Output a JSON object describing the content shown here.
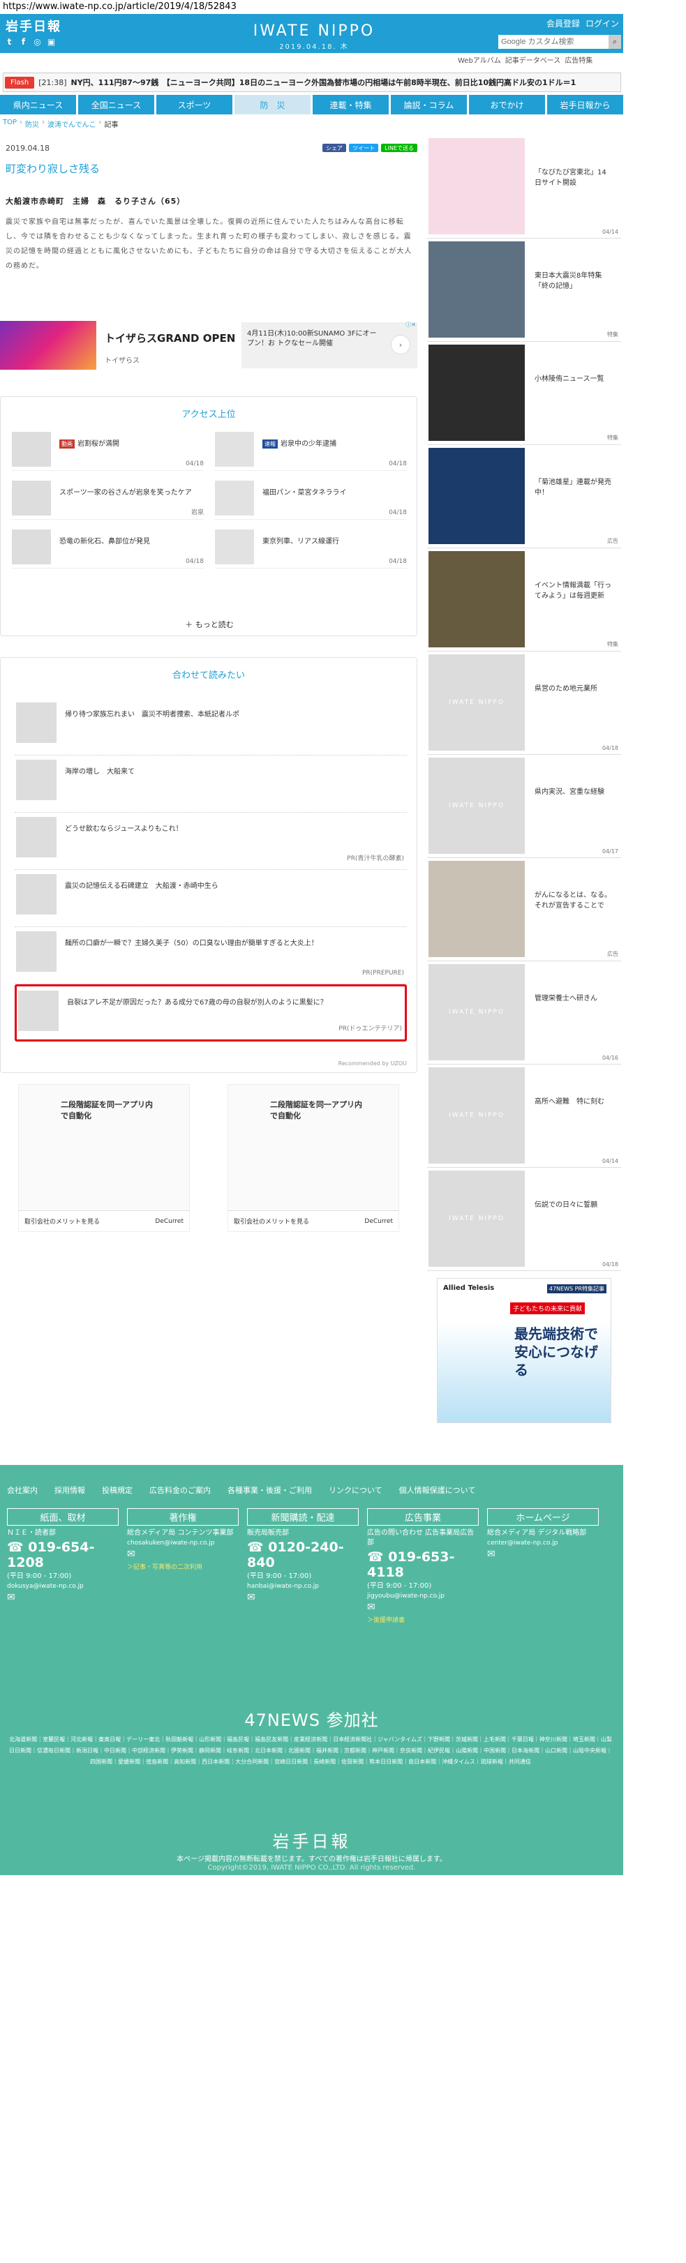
{
  "url": "https://www.iwate-np.co.jp/article/2019/4/18/52843",
  "header": {
    "logo": "岩手日報",
    "brand": "IWATE NIPPO",
    "date": "2019.04.18. 木",
    "member_links": [
      "会員登録",
      "ログイン"
    ],
    "search_placeholder": "Google カスタム検索",
    "sub_links": [
      "Webアルバム",
      "記事データベース",
      "広告特集"
    ],
    "social_icons": [
      "twitter-icon",
      "facebook-icon",
      "line-icon",
      "instagram-icon"
    ]
  },
  "flash": {
    "badge": "Flash",
    "time": "[21:38]",
    "text": "NY円、111円87～97銭　【ニューヨーク共同】18日のニューヨーク外国為替市場の円相場は午前8時半現在、前日比10銭円高ドル安の1ドル＝1"
  },
  "nav": [
    "県内ニュース",
    "全国ニュース",
    "スポーツ",
    "防　災",
    "連載・特集",
    "論説・コラム",
    "おでかけ",
    "岩手日報から"
  ],
  "breadcrumb": [
    "TOP",
    "防災",
    "波涛でんでんこ",
    "記事"
  ],
  "article": {
    "date": "2019.04.18",
    "title": "町変わり寂しさ残る",
    "byline": "大船渡市赤崎町　主婦　森　るり子さん（65）",
    "body": "震災で家族や自宅は無事だったが、喜んでいた風景は全壊した。復興の近所に住んでいた人たちはみんな高台に移転し、今では隣を合わせることも少なくなってしまった。生まれ育った町の様子も変わってしまい、寂しさを感じる。震災の記憶を時間の経過とともに風化させないためにも、子どもたちに自分の命は自分で守る大切さを伝えることが大人の務めだ。",
    "share": [
      "シェア",
      "ツイート",
      "LINEで送る"
    ]
  },
  "ad1": {
    "title": "トイザらスGRAND OPEN",
    "advertiser": "トイザらス",
    "text": "4月11日(木)10:00新SUNAMO 3Fにオープン！お トクなセール開催"
  },
  "access": {
    "title": "アクセス上位",
    "items": [
      {
        "tag": "動画",
        "tag_color": "#c83a2e",
        "text": "岩割桜が満開",
        "date": "04/18"
      },
      {
        "tag": "速報",
        "tag_color": "#1f4e9e",
        "text": "岩泉中の少年逮捕",
        "date": "04/18"
      },
      {
        "tag": "",
        "tag_color": "",
        "text": "スポーツ一家の谷さんが岩泉を笑ったケア",
        "date": "岩泉"
      },
      {
        "tag": "",
        "tag_color": "",
        "text": "福田パン・菜宮タネラライ",
        "date": "04/18"
      },
      {
        "tag": "",
        "tag_color": "",
        "text": "恐竜の新化石、鼻部位が発見",
        "date": "04/18"
      },
      {
        "tag": "",
        "tag_color": "",
        "text": "東京列車、リアス線運行",
        "date": "04/18"
      }
    ],
    "more": "もっと読む"
  },
  "related": {
    "title": "合わせて読みたい",
    "items": [
      {
        "text": "帰り待つ家族忘れまい　震災不明者捜索、本紙記者ルポ",
        "pr": ""
      },
      {
        "text": "海岸の増し　大船来て",
        "pr": ""
      },
      {
        "text": "どうせ飲むならジュースよりもこれ！",
        "pr": "PR(青汁牛乳の酵素)"
      },
      {
        "text": "震災の記憶伝える石碑建立　大船渡・赤崎中生ら",
        "pr": ""
      },
      {
        "text": "麺所の口癖が一瞬で？主婦久美子（50）の口臭ない理由が簡単すぎると大炎上！",
        "pr": "PR(PREPURE)"
      },
      {
        "text": "自裂はアレ不足が原因だった？ある成分で67歳の母の自裂が別人のように黒髪に？",
        "pr": "PR(ドゥエンテテリア)"
      }
    ],
    "recommended": "Recommended by UZOU"
  },
  "ads2": [
    {
      "headline": "二段階認証を同一アプリ内で自動化",
      "brand": "DeCurret",
      "caption": "取引会社のメリットを見る"
    },
    {
      "headline": "二段階認証を同一アプリ内で自動化",
      "brand": "DeCurret",
      "caption": "取引会社のメリットを見る"
    }
  ],
  "sidebar": [
    {
      "text": "「なびたび宮東北」14日サイト開設",
      "meta": "04/14",
      "img": "#f6dbe6"
    },
    {
      "text": "東日本大震災8年特集「終の記憶」",
      "meta": "特集",
      "img": "#5d7183"
    },
    {
      "text": "小林陵侑ニュース一覧",
      "meta": "特集",
      "img": "#2c2c2c"
    },
    {
      "text": "「菊池雄星」連載が発売中！",
      "meta": "広告",
      "img": "#1b3b6b"
    },
    {
      "text": "イベント情報満載「行ってみよう」は毎週更新",
      "meta": "特集",
      "img": "#665a3f"
    },
    {
      "text": "県営のため地元業所",
      "meta": "04/18",
      "img": ""
    },
    {
      "text": "県内実況、宮重な経験",
      "meta": "04/17",
      "img": ""
    },
    {
      "text": "がんになるとは、なる。それが宣告することで",
      "meta": "広告",
      "img": "#c9c1b4"
    },
    {
      "text": "管理栄養士へ研きん",
      "meta": "04/16",
      "img": ""
    },
    {
      "text": "高所へ避難　特に刻む",
      "meta": "04/14",
      "img": ""
    },
    {
      "text": "伝説での日々に誓願",
      "meta": "04/18",
      "img": ""
    }
  ],
  "sidebar_banner": {
    "company": "Allied Telesis",
    "label": "47NEWS PR特集記事",
    "tagline": "子どもたちの未来に貢献",
    "headline": "最先端技術で安心につなげる"
  },
  "footer": {
    "links": [
      "会社案内",
      "採用情報",
      "投稿規定",
      "広告料金のご案内",
      "各種事業・後援・ご利用",
      "リンクについて",
      "個人情報保護について"
    ],
    "columns": [
      {
        "head": "紙面、取材",
        "sub": "ＮＩＥ・読者部",
        "tel": "019-654-1208",
        "hours": "(平日 9:00 - 17:00)",
        "mail": "dokusya@iwate-np.co.jp",
        "extra": ""
      },
      {
        "head": "著作権",
        "sub": "総合メディア局 コンテンツ事業部",
        "tel": "",
        "hours": "",
        "mail": "chosakuken@iwate-np.co.jp",
        "extra": "＞記事・写真等の二次利用"
      },
      {
        "head": "新聞購読・配達",
        "sub": "販売局販売部",
        "tel": "0120-240-840",
        "hours": "(平日 9:00 - 17:00)",
        "mail": "hanbai@iwate-np.co.jp",
        "extra": ""
      },
      {
        "head": "広告事業",
        "sub": "広告の問い合わせ 広告事業局広告部",
        "tel": "019-653-4118",
        "hours": "(平日 9:00 - 17:00)",
        "mail": "jigyoubu@iwate-np.co.jp",
        "extra": "＞後援申請書"
      },
      {
        "head": "ホームページ",
        "sub": "総合メディア局 デジタル戦略部",
        "tel": "",
        "hours": "",
        "mail": "center@iwate-np.co.jp",
        "extra": ""
      }
    ],
    "news47": "47NEWS 参加社",
    "papers": "北海道新聞｜室蘭民報｜河北新報｜東奥日報｜デーリー東北｜秋田魁新報｜山形新聞｜福島民報｜福島民友新聞｜産業経済新聞｜日本経済新聞社｜ジャパンタイムズ｜下野新聞｜茨城新聞｜上毛新聞｜千葉日報｜神奈川新聞｜埼玉新聞｜山梨日日新聞｜信濃毎日新聞｜新潟日報｜中日新聞｜中部経済新聞｜伊勢新聞｜静岡新聞｜岐阜新聞｜北日本新聞｜北國新聞｜福井新聞｜京都新聞｜神戸新聞｜奈良新聞｜紀伊民報｜山陽新聞｜中国新聞｜日本海新聞｜山口新聞｜山陰中央新報｜四国新聞｜愛媛新聞｜徳島新聞｜高知新聞｜西日本新聞｜大分合同新聞｜宮崎日日新聞｜長崎新聞｜佐賀新聞｜熊本日日新聞｜南日本新聞｜沖縄タイムス｜琉球新報｜共同通信",
    "logo": "岩手日報",
    "note": "本ページ掲載内容の無断転載を禁じます。すべての著作権は岩手日報社に帰属します。",
    "copyright": "Copyright©2019, IWATE NIPPO CO.,LTD. All rights reserved."
  }
}
